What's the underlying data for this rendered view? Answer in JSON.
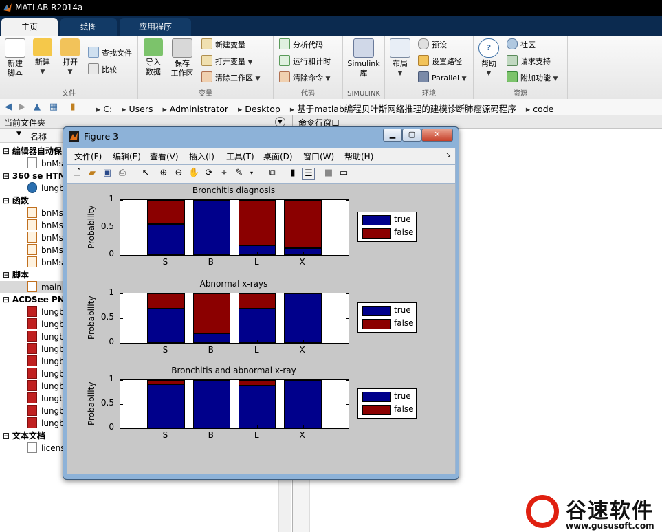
{
  "window": {
    "title": "MATLAB R2014a"
  },
  "tabs": [
    {
      "label": "主页",
      "active": true
    },
    {
      "label": "绘图",
      "active": false
    },
    {
      "label": "应用程序",
      "active": false
    }
  ],
  "ribbon": {
    "groups": {
      "file": "文件",
      "variable": "变量",
      "code": "代码",
      "simulink": "SIMULINK",
      "env": "环境",
      "resources": "资源"
    },
    "new_script": "新建\n脚本",
    "new": "新建",
    "open": "打开",
    "find_files": "查找文件",
    "compare": "比较",
    "import_data": "导入\n数据",
    "save_workspace": "保存\n工作区",
    "new_variable": "新建变量",
    "open_variable": "打开变量",
    "clear_workspace": "清除工作区",
    "analyze_code": "分析代码",
    "run_and_time": "运行和计时",
    "clear_commands": "清除命令",
    "simulink_lib": "Simulink\n库",
    "layout": "布局",
    "preferences": "预设",
    "set_path": "设置路径",
    "parallel": "Parallel",
    "help": "帮助",
    "community": "社区",
    "request_support": "请求支持",
    "addons": "附加功能"
  },
  "address": {
    "crumbs": [
      "C:",
      "Users",
      "Administrator",
      "Desktop",
      "基于matlab编程贝叶斯网络推理的建模诊断肺癌源码程序",
      "code"
    ]
  },
  "current_folder": {
    "title": "当前文件夹",
    "col_name": "名称",
    "rows": [
      {
        "text": "编辑器自动保",
        "group": true
      },
      {
        "text": "bnMs",
        "group": false
      },
      {
        "text": "360 se HTM",
        "group": true
      },
      {
        "text": "lungb",
        "group": false
      },
      {
        "text": "函数",
        "group": true
      },
      {
        "text": "bnMs",
        "group": false
      },
      {
        "text": "bnMs",
        "group": false
      },
      {
        "text": "bnMs",
        "group": false
      },
      {
        "text": "bnMs",
        "group": false
      },
      {
        "text": "bnMs",
        "group": false
      },
      {
        "text": "脚本",
        "group": true
      },
      {
        "text": "main.",
        "group": false
      },
      {
        "text": "ACDSee PN",
        "group": true
      },
      {
        "text": "lungb",
        "group": false
      },
      {
        "text": "lungb",
        "group": false
      },
      {
        "text": "lungb",
        "group": false
      },
      {
        "text": "lungb",
        "group": false
      },
      {
        "text": "lungb",
        "group": false
      },
      {
        "text": "lungb",
        "group": false
      },
      {
        "text": "lungb",
        "group": false
      },
      {
        "text": "lungb",
        "group": false
      },
      {
        "text": "lungb",
        "group": false
      },
      {
        "text": "lungb",
        "group": false
      },
      {
        "text": "文本文档",
        "group": true
      },
      {
        "text": "licens",
        "group": false
      }
    ]
  },
  "command_window": {
    "title": "命令行窗口"
  },
  "figure": {
    "title": "Figure 3",
    "menu": [
      "文件(F)",
      "编辑(E)",
      "查看(V)",
      "插入(I)",
      "工具(T)",
      "桌面(D)",
      "窗口(W)",
      "帮助(H)"
    ]
  },
  "chart_data": [
    {
      "type": "bar",
      "stacked": true,
      "title": "Bronchitis diagnosis",
      "ylabel": "Probability",
      "categories": [
        "S",
        "B",
        "L",
        "X"
      ],
      "series": [
        {
          "name": "true",
          "values": [
            0.56,
            1.0,
            0.17,
            0.12
          ],
          "color": "#00008b"
        },
        {
          "name": "false",
          "values": [
            0.44,
            0.0,
            0.83,
            0.88
          ],
          "color": "#8b0000"
        }
      ],
      "ylim": [
        0,
        1
      ],
      "yticks": [
        "0",
        "0.5",
        "1"
      ],
      "legend_position": "right"
    },
    {
      "type": "bar",
      "stacked": true,
      "title": "Abnormal x-rays",
      "ylabel": "Probability",
      "categories": [
        "S",
        "B",
        "L",
        "X"
      ],
      "series": [
        {
          "name": "true",
          "values": [
            0.69,
            0.2,
            0.69,
            1.0
          ],
          "color": "#00008b"
        },
        {
          "name": "false",
          "values": [
            0.31,
            0.8,
            0.31,
            0.0
          ],
          "color": "#8b0000"
        }
      ],
      "ylim": [
        0,
        1
      ],
      "yticks": [
        "0",
        "0.5",
        "1"
      ],
      "legend_position": "right"
    },
    {
      "type": "bar",
      "stacked": true,
      "title": "Bronchitis and abnormal x-ray",
      "ylabel": "Probability",
      "categories": [
        "S",
        "B",
        "L",
        "X"
      ],
      "series": [
        {
          "name": "true",
          "values": [
            0.91,
            1.0,
            0.88,
            1.0
          ],
          "color": "#00008b"
        },
        {
          "name": "false",
          "values": [
            0.09,
            0.0,
            0.12,
            0.0
          ],
          "color": "#8b0000"
        }
      ],
      "ylim": [
        0,
        1
      ],
      "yticks": [
        "0",
        "0.5",
        "1"
      ],
      "legend_position": "right"
    }
  ],
  "watermark": {
    "name": "谷速软件",
    "url": "www.gususoft.com"
  }
}
